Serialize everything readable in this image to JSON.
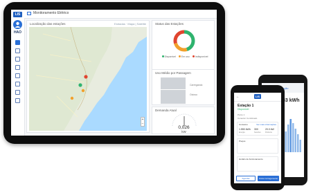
{
  "app": {
    "logo_text": "LIS",
    "window_title": "Monitoramento Elétrico",
    "user_code": "HAO"
  },
  "map": {
    "title": "Localização das estações",
    "view_links": "Estradas · Mapa | Satélite",
    "zoom_in": "+",
    "zoom_out": "−"
  },
  "status": {
    "title": "Status das Estações",
    "legend": [
      "Disponível",
      "Em uso",
      "Indisponível"
    ],
    "colors": {
      "available": "#2fb36e",
      "in_use": "#f2a02b",
      "unavailable": "#e0452f"
    },
    "segments": [
      0.45,
      0.25,
      0.3
    ]
  },
  "passage": {
    "title": "Uso Médio por Passagem",
    "label_top": "Carregando",
    "label_bottom": "Ocioso"
  },
  "demand": {
    "title": "Demanda Atual",
    "value": "0,026",
    "unit": "kW"
  },
  "mobile": {
    "logo_text": "LIS",
    "back": "←",
    "station_title": "Estação 1",
    "station_status": "Disponível",
    "info_a": "Ponto 1",
    "info_b": "Conector Combinado",
    "section1_title": "Consumo",
    "section1_link": "Ver mais informações",
    "n1": "1.550 kWh",
    "n1_label": "Energia",
    "n2": "300",
    "n2_label": "Sessões",
    "n3": "20.0 kW",
    "n3_label": "Potência",
    "section2_title": "Preços",
    "section3_title": "Horário de funcionamento",
    "btn_left": "Agendar",
    "btn_right": "Iniciar carregamento"
  },
  "mobile_back": {
    "header": "Estação",
    "big_value": "33 kWh"
  }
}
